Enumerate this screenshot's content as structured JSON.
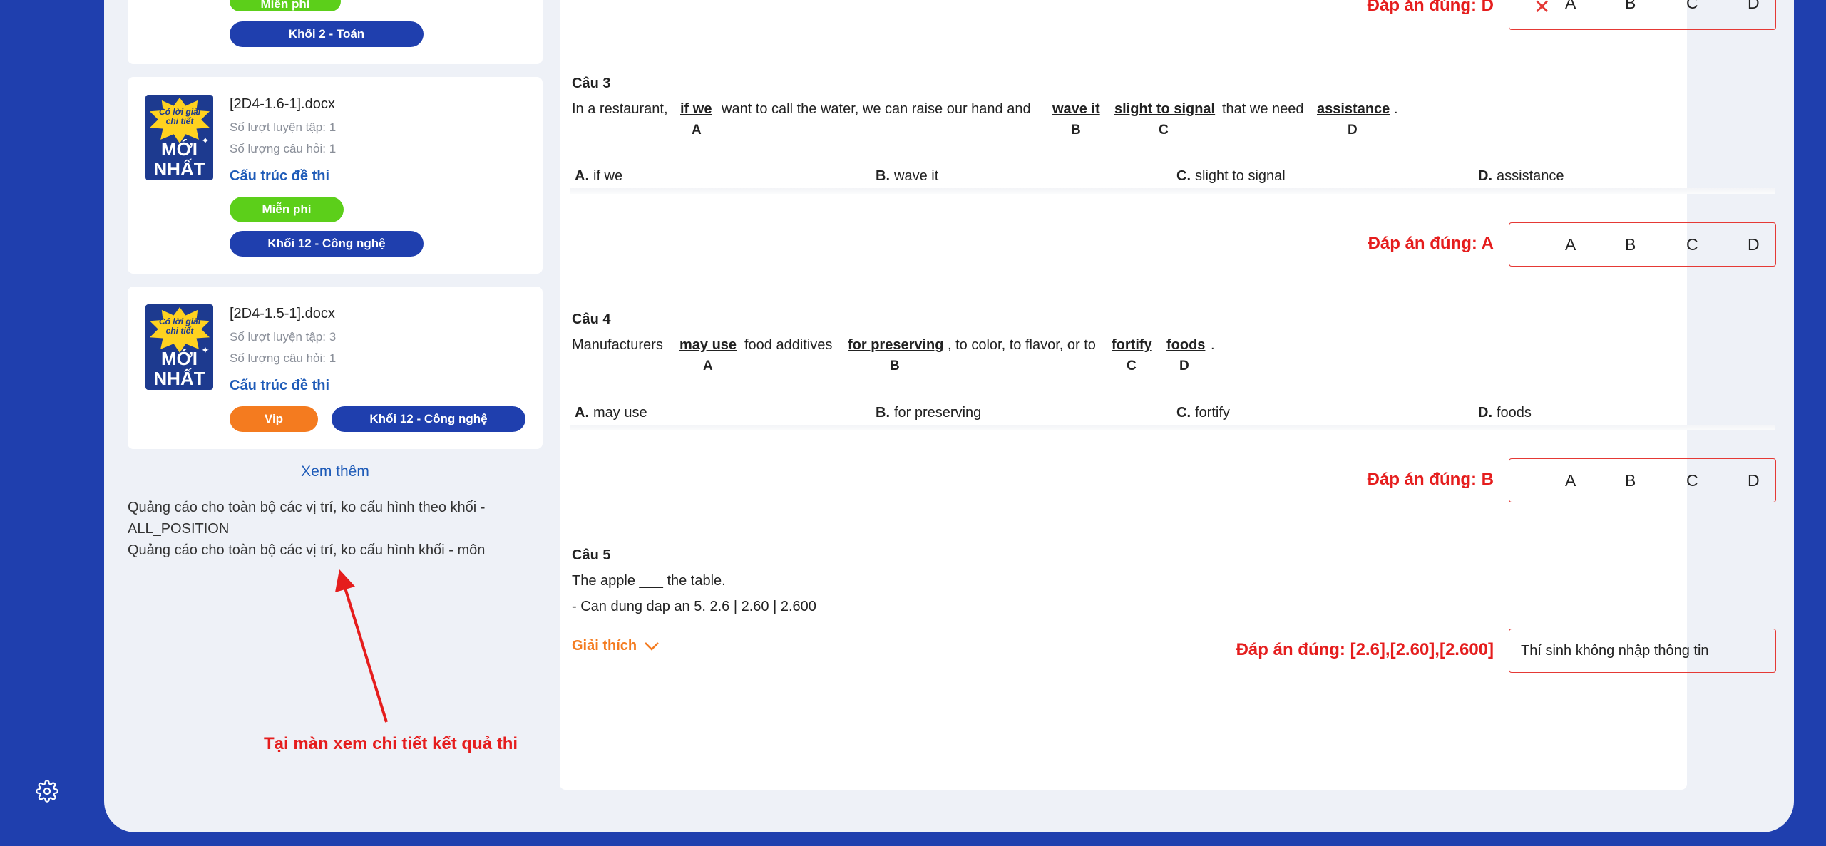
{
  "sidebar": {
    "cards": [
      {
        "tags": [
          "Miễn phí",
          "Khối 2 - Toán"
        ]
      },
      {
        "thumb_top": "Có lời giải chi tiết",
        "thumb_main": "MỚI NHẤT",
        "title": "[2D4-1.6-1].docx",
        "practice_count": "Số lượt luyện tập: 1",
        "question_count": "Số lượng câu hỏi: 1",
        "link": "Cấu trúc đề thi",
        "tags": [
          "Miễn phí",
          "Khối 12 - Công nghệ"
        ]
      },
      {
        "thumb_top": "Có lời giải chi tiết",
        "thumb_main": "MỚI NHẤT",
        "title": "[2D4-1.5-1].docx",
        "practice_count": "Số lượt luyện tập: 3",
        "question_count": "Số lượng câu hỏi: 1",
        "link": "Cấu trúc đề thi",
        "tags": [
          "Vip",
          "Khối 12 - Công nghệ"
        ]
      }
    ],
    "see_more": "Xem thêm",
    "ads": [
      "Quảng cáo cho toàn bộ các vị trí, ko cấu hình theo khối -",
      "ALL_POSITION",
      "Quảng cáo cho toàn bộ các vị trí, ko cấu hình khối - môn"
    ]
  },
  "annotation": "Tại màn xem chi tiết kết quả thi",
  "options": [
    "A",
    "B",
    "C",
    "D"
  ],
  "questions": {
    "q2": {
      "correct": "Đáp án đúng: D"
    },
    "q3": {
      "title": "Câu 3",
      "parts": [
        "In a restaurant,",
        "if we",
        "want to call the water, we can raise our hand and",
        "wave it",
        "slight to signal",
        "that we need",
        "assistance",
        "."
      ],
      "choices": [
        {
          "letter": "A.",
          "text": "if we"
        },
        {
          "letter": "B.",
          "text": "wave it"
        },
        {
          "letter": "C.",
          "text": "slight to signal"
        },
        {
          "letter": "D.",
          "text": "assistance"
        }
      ],
      "correct": "Đáp án đúng: A"
    },
    "q4": {
      "title": "Câu 4",
      "parts": [
        "Manufacturers",
        "may use",
        "food additives",
        "for preserving",
        ", to color, to flavor, or to",
        "fortify",
        "foods",
        "."
      ],
      "choices": [
        {
          "letter": "A.",
          "text": "may use"
        },
        {
          "letter": "B.",
          "text": "for preserving"
        },
        {
          "letter": "C.",
          "text": "fortify"
        },
        {
          "letter": "D.",
          "text": "foods"
        }
      ],
      "correct": "Đáp án đúng: B"
    },
    "q5": {
      "title": "Câu 5",
      "line1": "The apple ___ the table.",
      "line2": "- Can dung dap an 5. 2.6 | 2.60 | 2.600",
      "explain": "Giải thích",
      "correct": "Đáp án đúng: [2.6],[2.60],[2.600]",
      "user_answer": "Thí sinh không nhập thông tin"
    }
  },
  "colors": {
    "brand_blue": "#1f3fae",
    "correct_red": "#e51d1d",
    "free_green": "#5ccf1a",
    "vip_orange": "#f47b1f",
    "link_blue": "#1e5bb8"
  }
}
